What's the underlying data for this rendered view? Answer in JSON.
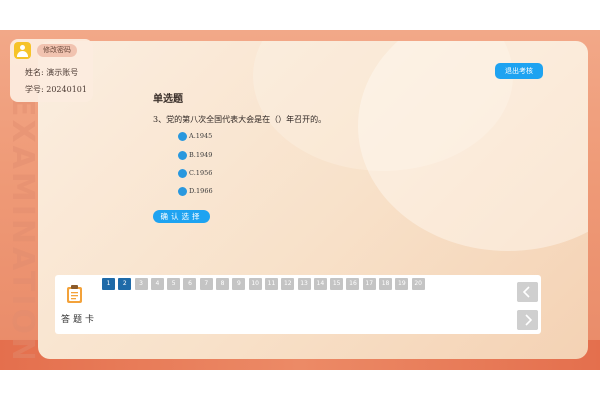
{
  "user": {
    "change_password_label": "修改密码",
    "name_label": "姓名:",
    "name_value": "演示账号",
    "id_label": "学号:",
    "id_value": "20240101"
  },
  "header": {
    "logout_label": "退出考核"
  },
  "question": {
    "type_label": "单选题",
    "text": "3、党的第八次全国代表大会是在（）年召开的。",
    "options": [
      {
        "label": "A.1945"
      },
      {
        "label": "B.1949"
      },
      {
        "label": "C.1956"
      },
      {
        "label": "D.1966"
      }
    ],
    "confirm_label": "确认选择"
  },
  "answer_sheet": {
    "title": "答题卡",
    "question_numbers": [
      "1",
      "2",
      "3",
      "4",
      "5",
      "6",
      "7",
      "8",
      "9",
      "10",
      "11",
      "12",
      "13",
      "14",
      "15",
      "16",
      "17",
      "18",
      "19",
      "20"
    ],
    "answered": [
      1,
      2
    ]
  },
  "decor": {
    "side_watermark": "EXAMINATION"
  },
  "colors": {
    "accent_blue": "#1ea3f1",
    "answered_blue": "#1e6aa8",
    "unanswered_gray": "#c4c4c4",
    "frame_orange": "#ef9b78"
  }
}
